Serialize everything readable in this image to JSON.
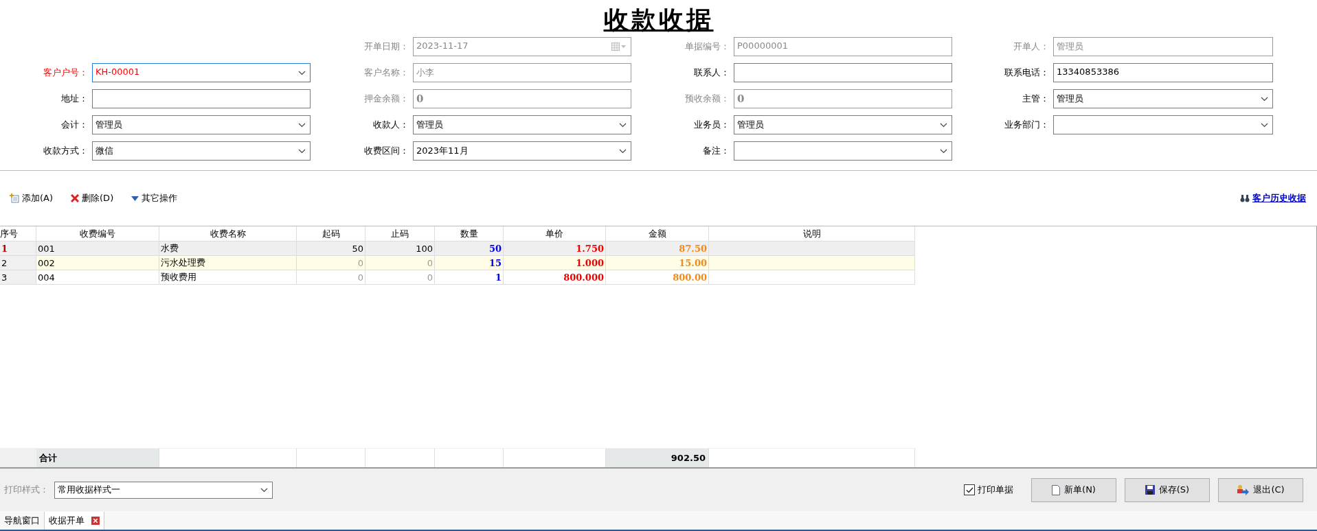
{
  "title": "收款收据",
  "form": {
    "rows": [
      [
        null,
        {
          "label": "开单日期：",
          "value": "2023-11-17",
          "kind": "date",
          "disabled": true,
          "required": false,
          "focused": false
        },
        {
          "label": "单据编号：",
          "value": "P00000001",
          "kind": "text",
          "disabled": true,
          "required": false,
          "focused": false
        },
        {
          "label": "开单人：",
          "value": "管理员",
          "kind": "text",
          "disabled": true,
          "required": false,
          "focused": false
        }
      ],
      [
        {
          "label": "客户户号：",
          "value": "KH-00001",
          "kind": "combo",
          "disabled": false,
          "required": true,
          "focused": true
        },
        {
          "label": "客户名称：",
          "value": "小李",
          "kind": "text",
          "disabled": true,
          "required": false,
          "focused": false
        },
        {
          "label": "联系人：",
          "kind": "text",
          "disabled": false,
          "required": false,
          "focused": false
        },
        {
          "label": "联系电话：",
          "value": "13340853386",
          "kind": "text",
          "disabled": false,
          "required": false,
          "focused": false
        }
      ],
      [
        {
          "label": "地址：",
          "kind": "text",
          "disabled": false,
          "required": false,
          "focused": false
        },
        {
          "label": "押金余额：",
          "value": "0",
          "kind": "amount",
          "disabled": true,
          "required": false,
          "focused": false
        },
        {
          "label": "预收余额：",
          "value": "0",
          "kind": "amount",
          "disabled": true,
          "required": false,
          "focused": false
        },
        {
          "label": "主管：",
          "value": "管理员",
          "kind": "combo",
          "disabled": false,
          "required": false,
          "focused": false
        }
      ],
      [
        {
          "label": "会计：",
          "value": "管理员",
          "kind": "combo",
          "disabled": false,
          "required": false,
          "focused": false
        },
        {
          "label": "收款人：",
          "value": "管理员",
          "kind": "combo",
          "disabled": false,
          "required": false,
          "focused": false
        },
        {
          "label": "业务员：",
          "value": "管理员",
          "kind": "combo",
          "disabled": false,
          "required": false,
          "focused": false
        },
        {
          "label": "业务部门：",
          "kind": "combo",
          "disabled": false,
          "required": false,
          "focused": false
        }
      ],
      [
        {
          "label": "收款方式：",
          "value": "微信",
          "kind": "combo",
          "disabled": false,
          "required": false,
          "focused": false
        },
        {
          "label": "收费区间：",
          "value": "2023年11月",
          "kind": "combo",
          "disabled": false,
          "required": false,
          "focused": false
        },
        {
          "label": "备注：",
          "kind": "combo",
          "disabled": false,
          "required": false,
          "focused": false
        },
        null
      ]
    ]
  },
  "toolbar": {
    "actions": [
      {
        "kind": "add",
        "label": "添加(A)"
      },
      {
        "kind": "delete",
        "label": "删除(D)"
      },
      {
        "kind": "more",
        "label": "其它操作"
      }
    ],
    "link": "客户历史收据"
  },
  "table": {
    "columns": [
      "序号",
      "收费编号",
      "收费名称",
      "起码",
      "止码",
      "数量",
      "单价",
      "金额",
      "说明"
    ],
    "rows": [
      {
        "index": "1",
        "code": "001",
        "name": "水费",
        "start": "50",
        "end": "100",
        "qty": "50",
        "price": "1.750",
        "amount": "87.50",
        "selected": true,
        "metered": true
      },
      {
        "index": "2",
        "code": "002",
        "name": "污水处理费",
        "start": "0",
        "end": "0",
        "qty": "15",
        "price": "1.000",
        "amount": "15.00",
        "selected": false,
        "metered": false
      },
      {
        "index": "3",
        "code": "004",
        "name": "预收费用",
        "start": "0",
        "end": "0",
        "qty": "1",
        "price": "800.000",
        "amount": "800.00",
        "selected": false,
        "metered": false
      }
    ],
    "total_label": "合计",
    "total_amount": "902.50"
  },
  "footer": {
    "print_style_label": "打印样式：",
    "print_style": "常用收据样式一",
    "print_receipt": {
      "label": "打印单据",
      "checked": true
    },
    "buttons": [
      {
        "kind": "new",
        "label": "新单(N)"
      },
      {
        "kind": "save",
        "label": "保存(S)"
      },
      {
        "kind": "exit",
        "label": "退出(C)"
      }
    ]
  },
  "tabs": [
    {
      "label": "导航窗口",
      "selected": false
    },
    {
      "label": "收据开单",
      "selected": true
    }
  ]
}
